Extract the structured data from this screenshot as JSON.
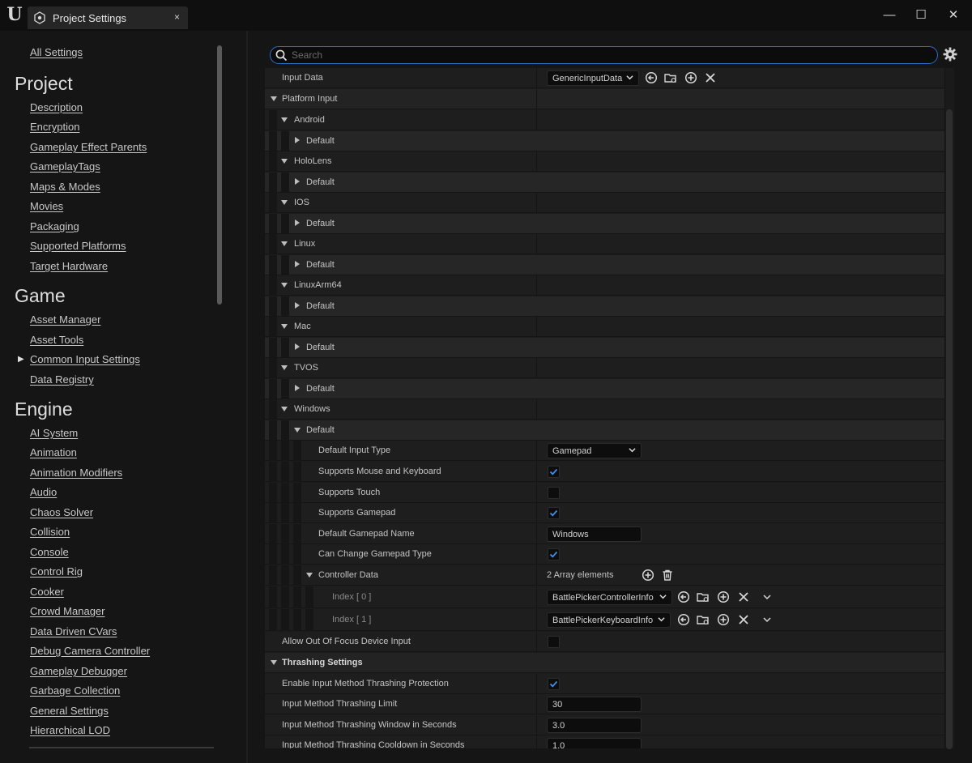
{
  "window": {
    "tab_title": "Project Settings",
    "tab_close": "×",
    "minimize": "—",
    "maximize": "☐",
    "close": "✕"
  },
  "sidebar": {
    "all_settings": "All Settings",
    "sections": [
      {
        "title": "Project",
        "items": [
          "Description",
          "Encryption",
          "Gameplay Effect Parents",
          "GameplayTags",
          "Maps & Modes",
          "Movies",
          "Packaging",
          "Supported Platforms",
          "Target Hardware"
        ]
      },
      {
        "title": "Game",
        "items": [
          "Asset Manager",
          "Asset Tools",
          "Common Input Settings",
          "Data Registry"
        ]
      },
      {
        "title": "Engine",
        "items": [
          "AI System",
          "Animation",
          "Animation Modifiers",
          "Audio",
          "Chaos Solver",
          "Collision",
          "Console",
          "Control Rig",
          "Cooker",
          "Crowd Manager",
          "Data Driven CVars",
          "Debug Camera Controller",
          "Gameplay Debugger",
          "Garbage Collection",
          "General Settings",
          "Hierarchical LOD"
        ]
      }
    ],
    "selected": "Common Input Settings"
  },
  "search": {
    "placeholder": "Search"
  },
  "details": {
    "input_data": {
      "label": "Input Data",
      "value": "GenericInputData"
    },
    "platform_input": "Platform Input",
    "platforms": [
      "Android",
      "HoloLens",
      "IOS",
      "Linux",
      "LinuxArm64",
      "Mac",
      "TVOS",
      "Windows"
    ],
    "default_label": "Default",
    "windows_default": {
      "default_input_type": {
        "label": "Default Input Type",
        "value": "Gamepad"
      },
      "supports_mouse_keyboard": {
        "label": "Supports Mouse and Keyboard",
        "checked": true
      },
      "supports_touch": {
        "label": "Supports Touch",
        "checked": false
      },
      "supports_gamepad": {
        "label": "Supports Gamepad",
        "checked": true
      },
      "default_gamepad_name": {
        "label": "Default Gamepad Name",
        "value": "Windows"
      },
      "can_change_gamepad_type": {
        "label": "Can Change Gamepad Type",
        "checked": true
      },
      "controller_data": {
        "label": "Controller Data",
        "count": "2 Array elements",
        "elements": [
          {
            "index": "Index [ 0 ]",
            "value": "BattlePickerControllerInfo"
          },
          {
            "index": "Index [ 1 ]",
            "value": "BattlePickerKeyboardInfo"
          }
        ]
      }
    },
    "allow_out_of_focus": {
      "label": "Allow Out Of Focus Device Input",
      "checked": false
    },
    "thrashing": {
      "title": "Thrashing Settings",
      "enable": {
        "label": "Enable Input Method Thrashing Protection",
        "checked": true
      },
      "limit": {
        "label": "Input Method Thrashing Limit",
        "value": "30"
      },
      "window": {
        "label": "Input Method Thrashing Window in Seconds",
        "value": "3.0"
      },
      "cooldown": {
        "label": "Input Method Thrashing Cooldown in Seconds",
        "value": "1.0"
      }
    }
  },
  "colors": {
    "accent": "#2a6fc9",
    "check": "#3d8ef0"
  }
}
